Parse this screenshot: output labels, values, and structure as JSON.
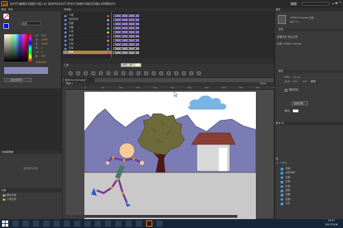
{
  "app": {
    "logo": "An"
  },
  "menu": {
    "items": [
      "文件(F)",
      "编辑(E)",
      "视图(V)",
      "插入(I)",
      "修改(M)",
      "文本(T)",
      "命令(C)",
      "控制(O)",
      "调试(D)",
      "窗口(W)",
      "帮助(H)"
    ]
  },
  "workspace": {
    "label": "动画"
  },
  "left_panel": {
    "tabs": [
      "颜色",
      "样本"
    ],
    "fill_type": "纯色",
    "channels": [
      {
        "k": "H:",
        "v": "252°"
      },
      {
        "k": "S:",
        "v": "100%"
      },
      {
        "k": "B:",
        "v": "100%"
      },
      {
        "k": "R:",
        "v": "0"
      },
      {
        "k": "G:",
        "v": "0"
      },
      {
        "k": "B:",
        "v": "255"
      }
    ],
    "hex": "#0000FF",
    "alpha": "A: 100%",
    "add_swatch": "添加到样本"
  },
  "timeline": {
    "title": "时间轴",
    "layers": [
      "人物",
      "动作补间",
      "右腿",
      "左腿",
      "人物",
      "身体",
      "头部",
      "左臂",
      "右臂",
      "背景"
    ],
    "selected_index": 9
  },
  "toolbar": {
    "tooltip_text": "滤镜工具(T)",
    "label": "工具"
  },
  "stage": {
    "tab": "跑步.fla [Canvas]*",
    "scene": "场景 1",
    "zoom": "100%",
    "ruler_marks": [
      "0",
      "50",
      "100",
      "150",
      "200",
      "250",
      "300",
      "350",
      "400",
      "450",
      "500",
      "550"
    ],
    "colors": {
      "sky": "#ffffff",
      "mountain": "#7b7cb4",
      "tree": "#6e6a3a",
      "roof": "#8a3d35",
      "house": "#d9d9d9",
      "ground": "#c9c9c9",
      "sun_head": "#f5cc9a",
      "cloud": "#78b4e4"
    }
  },
  "library_left": {
    "title": "动画编辑器",
    "empty_text": "没有选中对象",
    "layers_title": "场景",
    "items": [
      "跑步元件",
      "人物元件"
    ]
  },
  "properties": {
    "tab": "属性",
    "doc_title": "HTML5 Canvas 文档",
    "doc_name": "跑步.fla",
    "section_publish": "发布",
    "publish_setting": "配置文件: 默认文件",
    "target_label": "目标: HTML5 Canvas",
    "section_props": "属性",
    "fps_label": "FPS:",
    "fps": "24.00",
    "size_label": "大小:",
    "size_w": "550",
    "size_h": "400",
    "size_unit": "像素",
    "scale_label": "缩放内容",
    "advanced": "高级设置",
    "stage_label": "舞台:",
    "library_tab": "库",
    "library_file": "跑步.fla",
    "library_items": [
      "背景",
      "动作补间",
      "左臂",
      "右臂",
      "头部",
      "身体",
      "左腿",
      "右腿",
      "元件"
    ],
    "count": "12 个项目"
  },
  "taskbar": {
    "time": "10:17",
    "date": "2017/11/6"
  }
}
